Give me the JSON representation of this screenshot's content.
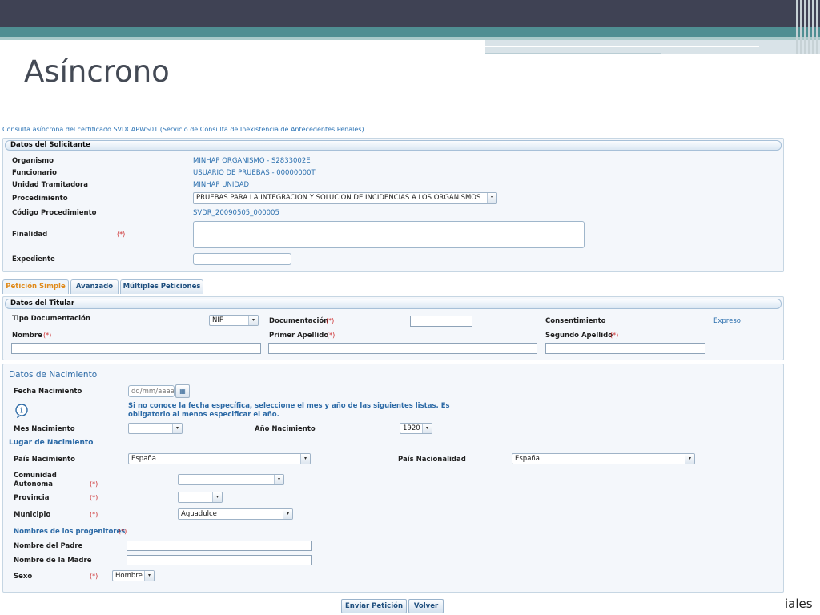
{
  "slide": {
    "title": "Asíncrono",
    "corner_text": "iales"
  },
  "form": {
    "caption": "Consulta asíncrona del certificado SVDCAPWS01 (Servicio de Consulta de Inexistencia de Antecedentes Penales)",
    "required_marker": "(*)"
  },
  "solicitante": {
    "header": "Datos del Solicitante",
    "organismo_label": "Organismo",
    "organismo_value": "MINHAP ORGANISMO - S2833002E",
    "funcionario_label": "Funcionario",
    "funcionario_value": "USUARIO DE PRUEBAS - 00000000T",
    "unidad_label": "Unidad Tramitadora",
    "unidad_value": "MINHAP UNIDAD",
    "procedimiento_label": "Procedimiento",
    "procedimiento_value": "PRUEBAS PARA LA INTEGRACION Y SOLUCION DE INCIDENCIAS A LOS ORGANISMOS",
    "codigo_label": "Código Procedimiento",
    "codigo_value": "SVDR_20090505_000005",
    "finalidad_label": "Finalidad",
    "finalidad_value": "",
    "expediente_label": "Expediente",
    "expediente_value": ""
  },
  "tabs": [
    {
      "label": "Petición Simple",
      "active": true
    },
    {
      "label": "Avanzado",
      "active": false
    },
    {
      "label": "Múltiples Peticiones",
      "active": false
    }
  ],
  "titular": {
    "header": "Datos del Titular",
    "tipo_doc_label": "Tipo Documentación",
    "tipo_doc_value": "NIF",
    "documentacion_label": "Documentación",
    "documentacion_value": "",
    "consentimiento_label": "Consentimiento",
    "consentimiento_value": "Expreso",
    "nombre_label": "Nombre",
    "nombre_value": "",
    "primer_apellido_label": "Primer Apellido",
    "primer_apellido_value": "",
    "segundo_apellido_label": "Segundo Apellido",
    "segundo_apellido_value": ""
  },
  "nacimiento": {
    "header": "Datos de Nacimiento",
    "fecha_label": "Fecha Nacimiento",
    "fecha_placeholder": "dd/mm/aaaa",
    "note": "Si no conoce la fecha específica, seleccione el mes y año de las siguientes listas. Es obligatorio al menos especificar el año.",
    "mes_label": "Mes Nacimiento",
    "mes_value": "",
    "anio_label": "Año Nacimiento",
    "anio_value": "1920",
    "lugar_header": "Lugar de Nacimiento",
    "pais_label": "País Nacimiento",
    "pais_value": "España",
    "nacionalidad_label": "País Nacionalidad",
    "nacionalidad_value": "España",
    "comunidad_label_1": "Comunidad",
    "comunidad_label_2": "Autonoma",
    "comunidad_value": "",
    "provincia_label": "Provincia",
    "provincia_value": "",
    "municipio_label": "Municipio",
    "municipio_value": "Aguadulce",
    "progenitores_header": "Nombres de los progenitores",
    "padre_label": "Nombre del Padre",
    "padre_value": "",
    "madre_label": "Nombre de la Madre",
    "madre_value": "",
    "sexo_label": "Sexo",
    "sexo_value": "Hombre"
  },
  "buttons": {
    "enviar": "Enviar Petición",
    "volver": "Volver"
  },
  "icons": {
    "dropdown": "▾",
    "calendar": "▦",
    "info": "i"
  },
  "colors": {
    "accent_blue": "#2b6fae",
    "required_red": "#cc2a2a",
    "active_tab": "#e08a1a",
    "header_dark": "#3f4254",
    "header_teal": "#4f8e92"
  }
}
